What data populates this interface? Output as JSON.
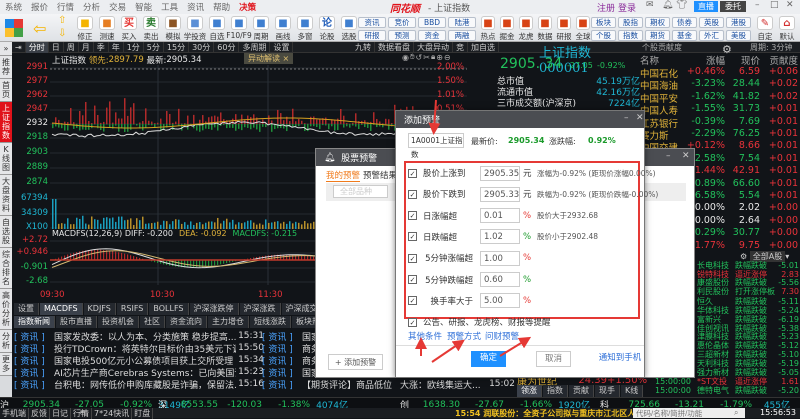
{
  "titlebar": {
    "menu": [
      "系统",
      "报价",
      "行情",
      "分析",
      "交易",
      "智能",
      "工具",
      "资讯",
      "帮助",
      "决策"
    ],
    "logo": "同花顺",
    "title": "- 上证指数",
    "register": "注册",
    "login": "登录",
    "live": "直播",
    "entrust": "委托"
  },
  "toolbar": {
    "buttons": [
      "修正",
      "测速",
      "买入",
      "卖出",
      "模拟",
      "学投资",
      "自选",
      "F10/F9",
      "周期",
      "画线",
      "多窗",
      "论股",
      "选股"
    ],
    "icons": [
      "",
      "",
      "买",
      "卖",
      "",
      "",
      "",
      "",
      "",
      "",
      "",
      "论",
      ""
    ],
    "small": [
      "资讯",
      "研报",
      "竞价",
      "预测",
      "BBD",
      "资金",
      "陆港",
      "两融"
    ],
    "buttons2": [
      "热点",
      "掘金",
      "龙虎",
      "数据",
      "研报",
      "全球"
    ],
    "small2": [
      "板块",
      "个股",
      "股指",
      "指数",
      "期权",
      "期货",
      "债券",
      "基金",
      "英股",
      "外汇",
      "港股",
      "美股"
    ],
    "buttons3": [
      "自定",
      "默认"
    ]
  },
  "periodbar": {
    "tabs": [
      "分时",
      "日",
      "周",
      "月",
      "季",
      "年",
      "1分",
      "5分",
      "15分",
      "30分",
      "60分",
      "多周期",
      "设置"
    ],
    "active": "分时",
    "right": [
      "九转",
      "数据看盘",
      "大盘异动",
      "竞",
      "加自选"
    ]
  },
  "lefttabs": [
    "推荐",
    "首页",
    "上证指数",
    "K线图",
    "大盘资料",
    "自选股",
    "综合排名",
    "高价分析",
    "分析",
    "更多"
  ],
  "chart": {
    "name": "上证指数",
    "lead_label": "领先:",
    "lead": "2897.79",
    "latest_label": "最新:",
    "latest": "2905.34",
    "anomaly": "异动解读",
    "price_ticks": [
      "2991",
      "2977",
      "2962",
      "2947",
      "2932",
      "2918",
      "2903",
      "2889",
      "2874"
    ],
    "pct_ticks": [
      "2.00%",
      "1.50%",
      "1.01%",
      "0.51%"
    ],
    "vol_ticks": [
      "67394",
      "34309",
      "X100"
    ],
    "macd_header": "MACDFS(12,26,9) DIFF: -0.200",
    "macd_dea": "DEA: -0.092",
    "macd_val": "MACDFS: -0.215",
    "macd_ticks": [
      "+2.72",
      "+0.946",
      "-0.901",
      "-2.68"
    ],
    "time_ticks": [
      "09:30",
      "10:30",
      "11:30"
    ]
  },
  "info": {
    "title": "上证指数 000001",
    "price": "2905. 34",
    "change": "-27.05",
    "pct": "-0.92%",
    "rows": [
      {
        "k": "总市值",
        "v": "45.19万亿"
      },
      {
        "k": "流通市值",
        "v": "42.16万亿"
      },
      {
        "k": "三市成交额(沪深京)",
        "v": "7224亿"
      }
    ]
  },
  "contrib": {
    "title": "个股贡献度",
    "period": "周期: 3分钟",
    "headers": [
      "名称",
      "涨幅",
      "现价",
      "贡献度"
    ],
    "rows": [
      {
        "n": "中国石化",
        "p": "+0.46%",
        "v": "6.59",
        "c": "+0.06"
      },
      {
        "n": "中国海油",
        "p": "-3.23%",
        "v": "28.44",
        "c": "+0.02"
      },
      {
        "n": "中国平安",
        "p": "-1.62%",
        "v": "41.82",
        "c": "+0.02"
      },
      {
        "n": "中国人寿",
        "p": "-1.55%",
        "v": "31.73",
        "c": "+0.01"
      },
      {
        "n": "江苏银行",
        "p": "-0.39%",
        "v": "7.69",
        "c": "+0.01"
      },
      {
        "n": "赛力斯",
        "p": "-2.29%",
        "v": "76.25",
        "c": "+0.01"
      },
      {
        "n": "中国交建",
        "p": "+0.12%",
        "v": "8.66",
        "c": "+0.01"
      },
      {
        "n": "",
        "p": "-2.58%",
        "v": "7.54",
        "c": "+0.01"
      },
      {
        "n": "",
        "p": "+1.44%",
        "v": "42.91",
        "c": "+0.01"
      },
      {
        "n": "",
        "p": "-0.89%",
        "v": "66.60",
        "c": "+0.01"
      },
      {
        "n": "",
        "p": "-6.58%",
        "v": "5.54",
        "c": "+0.01"
      },
      {
        "n": "",
        "p": "+0.00%",
        "v": "2.02",
        "c": "+0.00"
      },
      {
        "n": "",
        "p": "+0.00%",
        "v": "2.64",
        "c": "+0.00"
      },
      {
        "n": "",
        "p": "-0.29%",
        "v": "30.77",
        "c": "+0.00"
      },
      {
        "n": "",
        "p": "+1.77%",
        "v": "9.75",
        "c": "+0.00"
      }
    ]
  },
  "alerts": {
    "filter": "全部A股",
    "rows": [
      {
        "t": "",
        "n": "长电科技",
        "s": "跌幅跌破",
        "v": "-5.01"
      },
      {
        "t": "",
        "n": "锐特科技",
        "s": "逼近涨停",
        "v": "2.83"
      },
      {
        "t": "",
        "n": "康盛股份",
        "s": "跌幅跌破",
        "v": "-5.56"
      },
      {
        "t": "",
        "n": "利民股份",
        "s": "打开涨停板",
        "v": "7.30"
      },
      {
        "t": "",
        "n": "恒久",
        "s": "跌幅跌破",
        "v": "-5.11"
      },
      {
        "t": "",
        "n": "华体科技",
        "s": "跌幅跌破",
        "v": "-5.24"
      },
      {
        "t": "",
        "n": "富新兴",
        "s": "跌幅跌破",
        "v": "-6.19"
      },
      {
        "t": "",
        "n": "佳创视讯",
        "s": "跌幅跌破",
        "v": "-5.38"
      },
      {
        "t": "",
        "n": "津膜科技",
        "s": "跌幅跌破",
        "v": "-5.23"
      },
      {
        "t": "",
        "n": "惠伦晶体",
        "s": "跌幅跌破",
        "v": "-5.12"
      },
      {
        "t": "",
        "n": "三超新材",
        "s": "跌幅跌破",
        "v": "-5.10"
      },
      {
        "t": "",
        "n": "天利科技",
        "s": "跌幅跌破",
        "v": "-5.19"
      },
      {
        "t": "15:00:00",
        "n": "强力新材",
        "s": "跌幅跌破",
        "v": "-5.05"
      },
      {
        "t": "15:00:00",
        "n": "*ST文投",
        "s": "逼近涨停",
        "v": "1.61"
      },
      {
        "t": "15:00:00",
        "n": "德特电气",
        "s": "跌幅跌破",
        "v": "-5.20"
      }
    ]
  },
  "leader": {
    "name": "康为世纪",
    "price": "24.39",
    "pct": "+1.50%",
    "tabs": [
      "领涨",
      "指数",
      "贡献",
      "现手",
      "K线"
    ]
  },
  "bottomtabs": {
    "row1": [
      "设置",
      "MACDFS",
      "KDJFS",
      "RSIFS",
      "BOLLFS",
      "沪深涨跌停",
      "沪深涨跌",
      "沪深成交额",
      "成交对比"
    ],
    "row2": [
      "指数新闻",
      "股市直播",
      "投资机会",
      "社区",
      "资金流向",
      "主力增仓",
      "短线涨跌",
      "板块热点",
      "关联指数"
    ]
  },
  "news": {
    "left": [
      {
        "tag": "[ 资讯 ]",
        "t": "国家发改委：以人为本、分类施策 稳步提高...",
        "tm": "15:31"
      },
      {
        "tag": "[ 资讯 ]",
        "t": "投行TDCrown：将英特尔目标价由35美元下调...",
        "tm": "15:50"
      },
      {
        "tag": "[ 资讯 ]",
        "t": "国家电投500亿元小公募债项目获上交所受理",
        "tm": "15:34"
      },
      {
        "tag": "[ 资讯 ]",
        "t": "AI芯片生产商Cerebras Systems：已向美国证监...",
        "tm": "15:23"
      },
      {
        "tag": "[ 资讯 ]",
        "t": "台积电：网传低价申购库藏股是诈骗，保留法...",
        "tm": "15:16"
      }
    ],
    "right": [
      {
        "tag": "[ 资讯 ]",
        "t": "国家"
      },
      {
        "tag": "[ 资讯 ]",
        "t": "商务"
      },
      {
        "tag": "[ 资讯 ]",
        "t": "商务"
      },
      {
        "tag": "[ 资讯 ]",
        "t": "国家"
      },
      {
        "tag": "[ 资讯 ]",
        "t": "【期货评论】商品低位反弹"
      }
    ],
    "extra": {
      "t": "大涨：欧线集运大...",
      "tm": "15:02"
    }
  },
  "status": {
    "sh": {
      "label": "沪",
      "price": "2905.34",
      "chg": "-27.05",
      "pct": "-0.92%",
      "amt": "3149亿"
    },
    "sz": {
      "label": "深",
      "price": "8553.55",
      "chg": "-120.03",
      "pct": "-1.38%",
      "amt": "4074亿"
    },
    "cy": {
      "label": "创",
      "price": "1638.30",
      "chg": "-27.67",
      "pct": "-1.66%",
      "amt": "1920亿"
    },
    "kc": {
      "label": "科",
      "price": "725.66",
      "chg": "-13.21",
      "pct": "-1.79%",
      "amt": "455亿"
    }
  },
  "bottombar": {
    "items": [
      "手机端",
      "反馈",
      "日记",
      "行情",
      "7*24快讯",
      "盯盘"
    ],
    "ticker": "15:54 润联股份：全资子公司拟与重庆市江北区人民政",
    "search_placeholder": "代码/名称/简拼/功能",
    "clock": "15:56:53"
  },
  "alert_window": {
    "title": "股票预警",
    "tab_mine": "我的预警",
    "tab_results": "预警结果",
    "filter": "全部品种",
    "add": "+ 添加预警"
  },
  "add_dialog": {
    "title": "添加预警",
    "stock": "1A0001上证指数",
    "latest_label": "最新价:",
    "latest": "2905.34",
    "chg_label": "涨跌幅:",
    "chg": "0.92%",
    "conditions": [
      {
        "label": "股价上涨到",
        "value": "2905.35",
        "unit": "元",
        "hint": "涨幅为-0.92% (距现价涨幅0.00%)",
        "checked": true
      },
      {
        "label": "股价下跌到",
        "value": "2905.33",
        "unit": "元",
        "hint": "跌幅为-0.92% (距现价跌幅-0.00%)",
        "checked": true
      },
      {
        "label": "日涨幅超",
        "value": "0.01",
        "unit": "%",
        "hint": "股价大于2932.68",
        "checked": true
      },
      {
        "label": "日跌幅超",
        "value": "1.02",
        "unit": "%",
        "hint": "股价小于2902.48",
        "checked": true
      },
      {
        "label": "5分钟涨幅超",
        "value": "1.00",
        "unit": "%",
        "hint": "",
        "checked": true
      },
      {
        "label": "5分钟跌幅超",
        "value": "0.60",
        "unit": "%",
        "hint": "",
        "checked": true
      },
      {
        "label": "换手率大于",
        "value": "5.00",
        "unit": "%",
        "hint": "",
        "checked": true
      },
      {
        "label": "公告、研报、龙虎榜、财报等提醒",
        "value": null,
        "unit": "",
        "hint": "",
        "checked": true
      }
    ],
    "links": [
      "其他条件",
      "预警方式",
      "问财预警"
    ],
    "ok": "确定",
    "cancel": "取消",
    "notify": "通知到手机"
  },
  "colors": {
    "up": "#e8333a",
    "down": "#22c15c",
    "accent": "#1e90ff",
    "highlight_box": "#e53935",
    "annotation_arrow": "#e53935"
  }
}
